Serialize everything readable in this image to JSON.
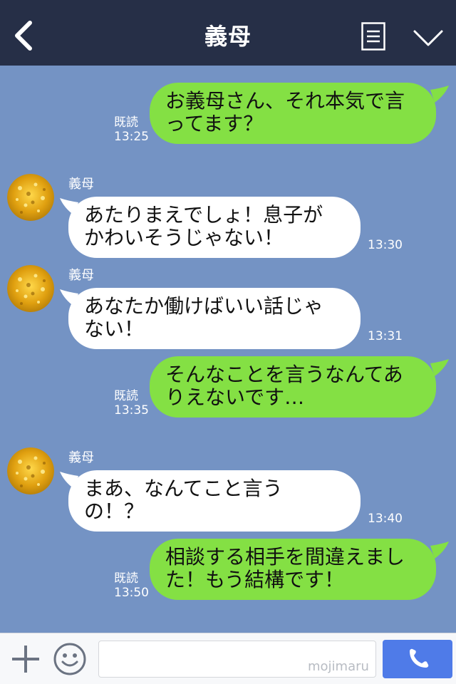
{
  "header": {
    "title": "義母"
  },
  "messages": [
    {
      "type": "out",
      "text": "お義母さん、それ本気で言ってます？",
      "read": "既読",
      "time": "13:25"
    },
    {
      "type": "in",
      "sender": "義母",
      "text": "あたりまえでしょ！息子がかわいそうじゃない！",
      "time": "13:30"
    },
    {
      "type": "in",
      "sender": "義母",
      "text": "あなたか働けばいい話じゃない！",
      "time": "13:31"
    },
    {
      "type": "out",
      "text": "そんなことを言うなんてありえないです…",
      "read": "既読",
      "time": "13:35"
    },
    {
      "type": "in",
      "sender": "義母",
      "text": "まあ、なんてこと言うの！？",
      "time": "13:40"
    },
    {
      "type": "out",
      "text": "相談する相手を間違えました！もう結構です！",
      "read": "既読",
      "time": "13:50"
    }
  ],
  "footer": {
    "input_value": "",
    "watermark": "mojimaru"
  },
  "colors": {
    "header_bg": "#262f47",
    "chat_bg": "#7493c4",
    "outgoing_bubble": "#84e044",
    "incoming_bubble": "#ffffff",
    "call_button": "#4f7be8"
  },
  "icons": {
    "back": "chevron-left-icon",
    "menu": "notes-icon",
    "collapse": "chevron-down-icon",
    "plus": "plus-icon",
    "emoji": "smiley-icon",
    "call": "phone-icon",
    "avatar": "gold-glitter-avatar"
  }
}
